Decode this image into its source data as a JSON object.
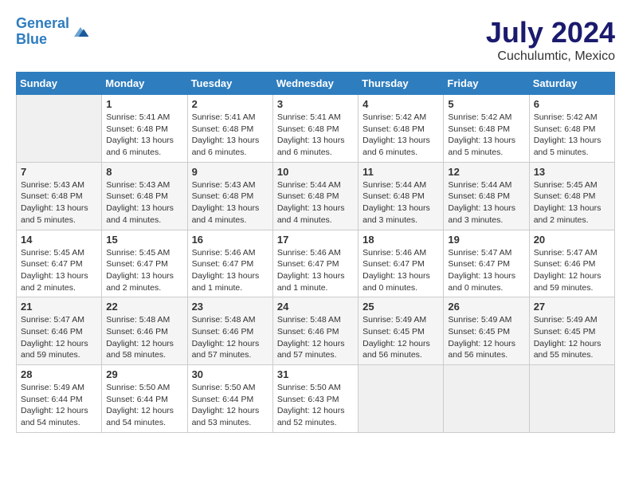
{
  "header": {
    "logo_line1": "General",
    "logo_line2": "Blue",
    "month_title": "July 2024",
    "location": "Cuchulumtic, Mexico"
  },
  "days_of_week": [
    "Sunday",
    "Monday",
    "Tuesday",
    "Wednesday",
    "Thursday",
    "Friday",
    "Saturday"
  ],
  "weeks": [
    [
      {
        "day": "",
        "empty": true
      },
      {
        "day": "1",
        "sunrise": "5:41 AM",
        "sunset": "6:48 PM",
        "daylight": "13 hours and 6 minutes."
      },
      {
        "day": "2",
        "sunrise": "5:41 AM",
        "sunset": "6:48 PM",
        "daylight": "13 hours and 6 minutes."
      },
      {
        "day": "3",
        "sunrise": "5:41 AM",
        "sunset": "6:48 PM",
        "daylight": "13 hours and 6 minutes."
      },
      {
        "day": "4",
        "sunrise": "5:42 AM",
        "sunset": "6:48 PM",
        "daylight": "13 hours and 6 minutes."
      },
      {
        "day": "5",
        "sunrise": "5:42 AM",
        "sunset": "6:48 PM",
        "daylight": "13 hours and 5 minutes."
      },
      {
        "day": "6",
        "sunrise": "5:42 AM",
        "sunset": "6:48 PM",
        "daylight": "13 hours and 5 minutes."
      }
    ],
    [
      {
        "day": "7",
        "sunrise": "5:43 AM",
        "sunset": "6:48 PM",
        "daylight": "13 hours and 5 minutes."
      },
      {
        "day": "8",
        "sunrise": "5:43 AM",
        "sunset": "6:48 PM",
        "daylight": "13 hours and 4 minutes."
      },
      {
        "day": "9",
        "sunrise": "5:43 AM",
        "sunset": "6:48 PM",
        "daylight": "13 hours and 4 minutes."
      },
      {
        "day": "10",
        "sunrise": "5:44 AM",
        "sunset": "6:48 PM",
        "daylight": "13 hours and 4 minutes."
      },
      {
        "day": "11",
        "sunrise": "5:44 AM",
        "sunset": "6:48 PM",
        "daylight": "13 hours and 3 minutes."
      },
      {
        "day": "12",
        "sunrise": "5:44 AM",
        "sunset": "6:48 PM",
        "daylight": "13 hours and 3 minutes."
      },
      {
        "day": "13",
        "sunrise": "5:45 AM",
        "sunset": "6:48 PM",
        "daylight": "13 hours and 2 minutes."
      }
    ],
    [
      {
        "day": "14",
        "sunrise": "5:45 AM",
        "sunset": "6:47 PM",
        "daylight": "13 hours and 2 minutes."
      },
      {
        "day": "15",
        "sunrise": "5:45 AM",
        "sunset": "6:47 PM",
        "daylight": "13 hours and 2 minutes."
      },
      {
        "day": "16",
        "sunrise": "5:46 AM",
        "sunset": "6:47 PM",
        "daylight": "13 hours and 1 minute."
      },
      {
        "day": "17",
        "sunrise": "5:46 AM",
        "sunset": "6:47 PM",
        "daylight": "13 hours and 1 minute."
      },
      {
        "day": "18",
        "sunrise": "5:46 AM",
        "sunset": "6:47 PM",
        "daylight": "13 hours and 0 minutes."
      },
      {
        "day": "19",
        "sunrise": "5:47 AM",
        "sunset": "6:47 PM",
        "daylight": "13 hours and 0 minutes."
      },
      {
        "day": "20",
        "sunrise": "5:47 AM",
        "sunset": "6:46 PM",
        "daylight": "12 hours and 59 minutes."
      }
    ],
    [
      {
        "day": "21",
        "sunrise": "5:47 AM",
        "sunset": "6:46 PM",
        "daylight": "12 hours and 59 minutes."
      },
      {
        "day": "22",
        "sunrise": "5:48 AM",
        "sunset": "6:46 PM",
        "daylight": "12 hours and 58 minutes."
      },
      {
        "day": "23",
        "sunrise": "5:48 AM",
        "sunset": "6:46 PM",
        "daylight": "12 hours and 57 minutes."
      },
      {
        "day": "24",
        "sunrise": "5:48 AM",
        "sunset": "6:46 PM",
        "daylight": "12 hours and 57 minutes."
      },
      {
        "day": "25",
        "sunrise": "5:49 AM",
        "sunset": "6:45 PM",
        "daylight": "12 hours and 56 minutes."
      },
      {
        "day": "26",
        "sunrise": "5:49 AM",
        "sunset": "6:45 PM",
        "daylight": "12 hours and 56 minutes."
      },
      {
        "day": "27",
        "sunrise": "5:49 AM",
        "sunset": "6:45 PM",
        "daylight": "12 hours and 55 minutes."
      }
    ],
    [
      {
        "day": "28",
        "sunrise": "5:49 AM",
        "sunset": "6:44 PM",
        "daylight": "12 hours and 54 minutes."
      },
      {
        "day": "29",
        "sunrise": "5:50 AM",
        "sunset": "6:44 PM",
        "daylight": "12 hours and 54 minutes."
      },
      {
        "day": "30",
        "sunrise": "5:50 AM",
        "sunset": "6:44 PM",
        "daylight": "12 hours and 53 minutes."
      },
      {
        "day": "31",
        "sunrise": "5:50 AM",
        "sunset": "6:43 PM",
        "daylight": "12 hours and 52 minutes."
      },
      {
        "day": "",
        "empty": true
      },
      {
        "day": "",
        "empty": true
      },
      {
        "day": "",
        "empty": true
      }
    ]
  ],
  "labels": {
    "sunrise_prefix": "Sunrise: ",
    "sunset_prefix": "Sunset: ",
    "daylight_prefix": "Daylight: "
  }
}
